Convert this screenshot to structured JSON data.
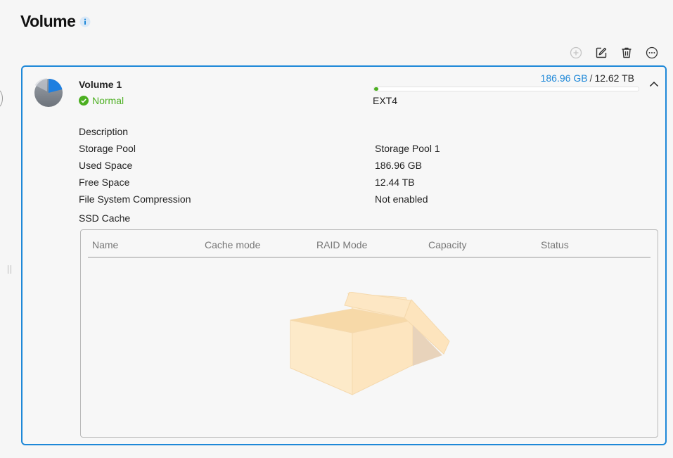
{
  "page": {
    "title": "Volume"
  },
  "toolbar": {
    "buttons": [
      {
        "icon": "plus-circle-icon",
        "enabled": false
      },
      {
        "icon": "edit-icon",
        "enabled": true
      },
      {
        "icon": "trash-icon",
        "enabled": true
      },
      {
        "icon": "more-icon",
        "enabled": true
      }
    ]
  },
  "volume": {
    "name": "Volume 1",
    "status": "Normal",
    "used": "186.96 GB",
    "separator": "/",
    "total": "12.62 TB",
    "usage_fraction": 0.015,
    "filesystem": "EXT4",
    "properties": [
      {
        "label": "Description",
        "value": ""
      },
      {
        "label": "Storage Pool",
        "value": "Storage Pool 1"
      },
      {
        "label": "Used Space",
        "value": "186.96 GB"
      },
      {
        "label": "Free Space",
        "value": "12.44 TB"
      },
      {
        "label": "File System Compression",
        "value": "Not enabled"
      },
      {
        "label": "SSD Cache",
        "value": ""
      }
    ]
  },
  "ssd_cache_table": {
    "columns": [
      "Name",
      "Cache mode",
      "RAID Mode",
      "Capacity",
      "Status"
    ],
    "rows": []
  },
  "colors": {
    "accent": "#1e88d8",
    "status_ok": "#4caf21",
    "empty_box": "#fde8c8"
  }
}
